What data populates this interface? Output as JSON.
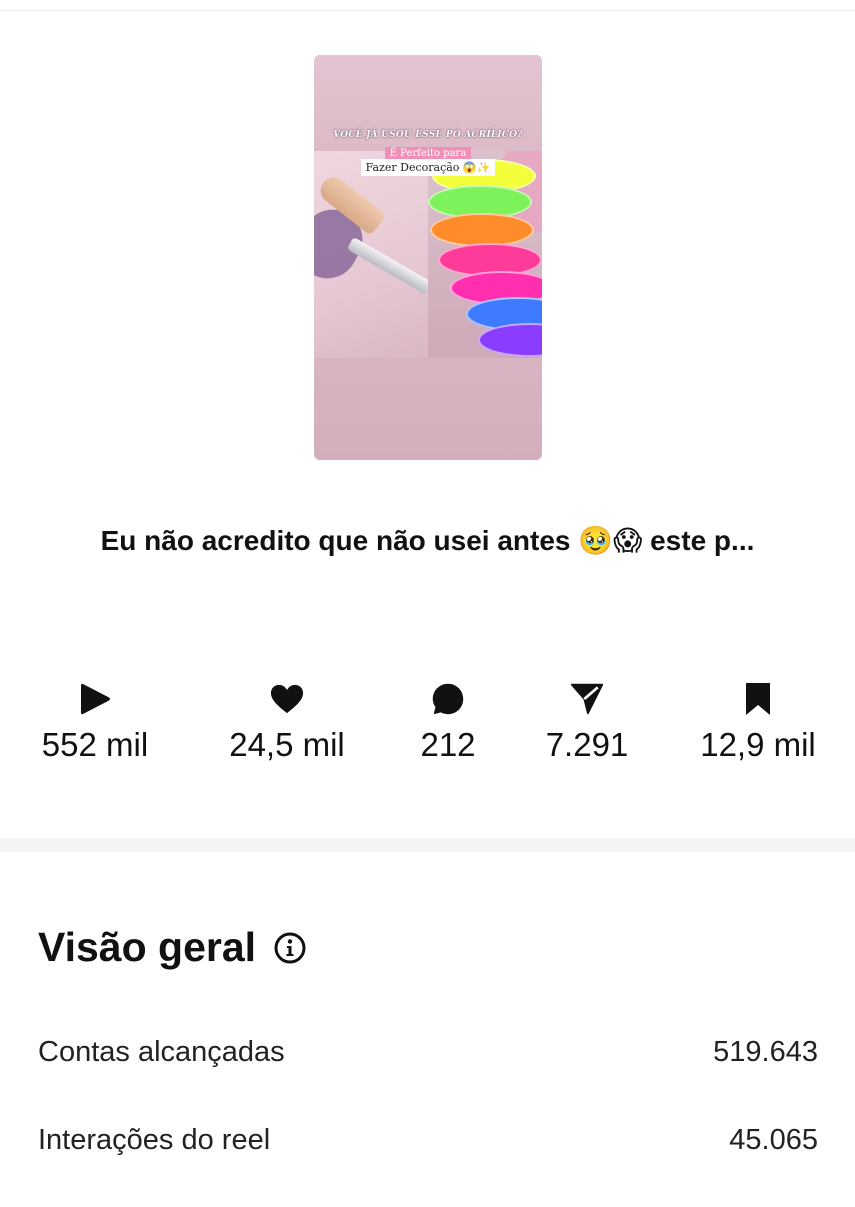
{
  "reel": {
    "thumbnail": {
      "overlay_line1": "VOCÊ JÁ USOU ESSE PÓ ACRÍLICO?",
      "overlay_line2": "É Perfeito para",
      "overlay_line3": "Fazer Decoração 😱✨"
    },
    "caption": "Eu não acredito que não usei antes 🥹😱 este p..."
  },
  "stats": {
    "plays": {
      "icon": "play-icon",
      "value": "552 mil"
    },
    "likes": {
      "icon": "heart-icon",
      "value": "24,5 mil"
    },
    "comments": {
      "icon": "comment-icon",
      "value": "212"
    },
    "shares": {
      "icon": "send-icon",
      "value": "7.291"
    },
    "saves": {
      "icon": "bookmark-icon",
      "value": "12,9 mil"
    }
  },
  "overview": {
    "title": "Visão geral",
    "info_icon": "info-icon",
    "rows": [
      {
        "label": "Contas alcançadas",
        "value": "519.643"
      },
      {
        "label": "Interações do reel",
        "value": "45.065"
      }
    ]
  },
  "colors": {
    "text": "#111111",
    "divider": "#f4f4f5",
    "thumbnail_bg": "#dcbcc8"
  }
}
